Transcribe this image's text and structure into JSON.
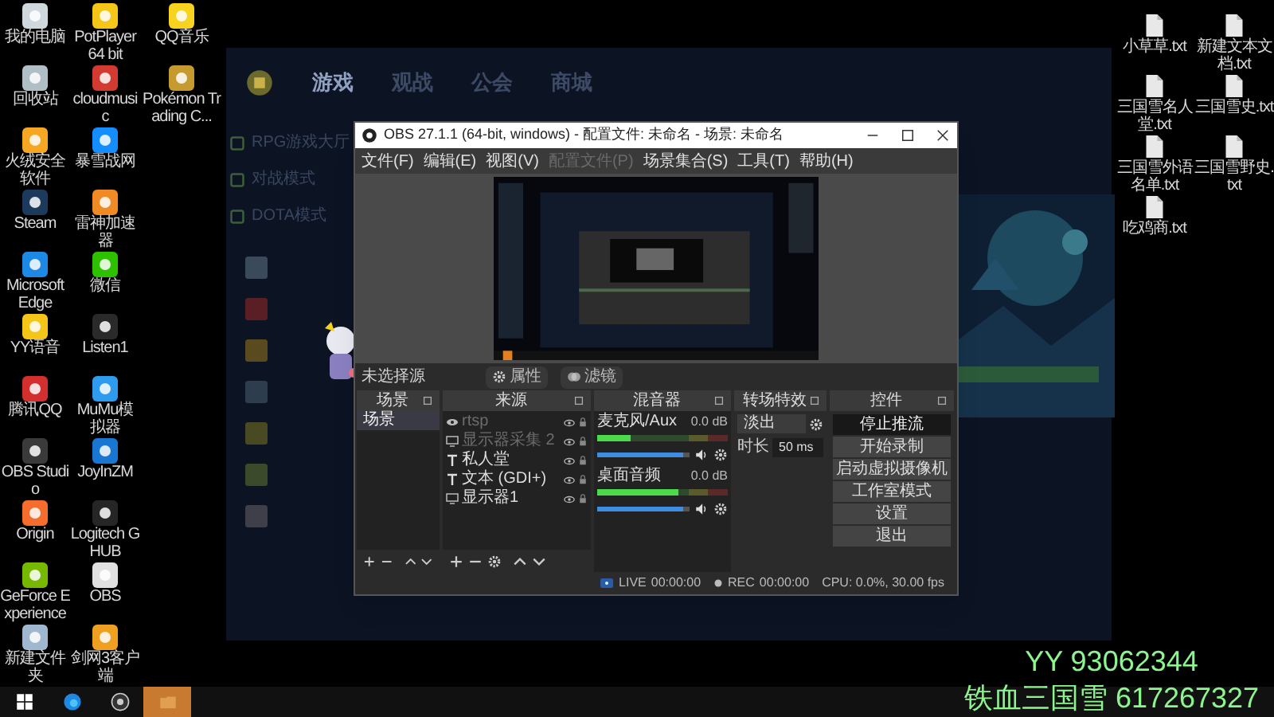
{
  "desktop_left": [
    [
      {
        "label": "我的电脑",
        "color": "#cfd8dc"
      },
      {
        "label": "回收站",
        "color": "#b0bec5"
      },
      {
        "label": "火绒安全软件",
        "color": "#f5a623"
      },
      {
        "label": "Steam",
        "color": "#1b3a5c"
      },
      {
        "label": "Microsoft Edge",
        "color": "#1e88e5"
      },
      {
        "label": "YY语音",
        "color": "#f5c518"
      },
      {
        "label": "腾讯QQ",
        "color": "#d32f2f"
      },
      {
        "label": "OBS Studio",
        "color": "#3a3a3a"
      },
      {
        "label": "Origin",
        "color": "#f56c2d"
      },
      {
        "label": "GeForce Experience",
        "color": "#76b900"
      },
      {
        "label": "新建文件夹",
        "color": "#9fb8d0"
      }
    ],
    [
      {
        "label": "PotPlayer 64 bit",
        "color": "#f5c518"
      },
      {
        "label": "cloudmusic",
        "color": "#d33a31"
      },
      {
        "label": "暴雪战网",
        "color": "#148eff"
      },
      {
        "label": "雷神加速器",
        "color": "#f08a24"
      },
      {
        "label": "微信",
        "color": "#2dc100"
      },
      {
        "label": "Listen1",
        "color": "#2a2a2a"
      },
      {
        "label": "MuMu模拟器",
        "color": "#2f9bef"
      },
      {
        "label": "JoyInZM",
        "color": "#1976d2"
      },
      {
        "label": "Logitech G HUB",
        "color": "#262626"
      },
      {
        "label": "OBS",
        "color": "#e0e0e0"
      },
      {
        "label": "剑网3客户端",
        "color": "#f0a020"
      }
    ],
    [
      {
        "label": "QQ音乐",
        "color": "#f7d21e"
      },
      {
        "label": "Pokémon Trading C...",
        "color": "#c59a2e"
      }
    ]
  ],
  "desktop_right": [
    "小草草.txt",
    "新建文本文档.txt",
    "三国雪名人堂.txt",
    "三国雪史.txt",
    "三国雪外语名单.txt",
    "三国雪野史.txt",
    "吃鸡商.txt"
  ],
  "game_client": {
    "nav": [
      {
        "label": "游戏",
        "selected": true
      },
      {
        "label": "观战",
        "selected": false
      },
      {
        "label": "公会",
        "selected": false
      },
      {
        "label": "商城",
        "selected": false
      }
    ],
    "sidebar": [
      "RPG游戏大厅",
      "对战模式",
      "DOTA模式"
    ]
  },
  "obs": {
    "title": "OBS 27.1.1 (64-bit, windows) - 配置文件: 未命名 - 场景: 未命名",
    "menu": [
      {
        "label": "文件(F)",
        "disabled": false
      },
      {
        "label": "编辑(E)",
        "disabled": false
      },
      {
        "label": "视图(V)",
        "disabled": false
      },
      {
        "label": "配置文件(P)",
        "disabled": true
      },
      {
        "label": "场景集合(S)",
        "disabled": false
      },
      {
        "label": "工具(T)",
        "disabled": false
      },
      {
        "label": "帮助(H)",
        "disabled": false
      }
    ],
    "source_bar": {
      "label": "未选择源",
      "buttons": [
        {
          "label": "属性",
          "kind": "gear"
        },
        {
          "label": "滤镜",
          "kind": "filter"
        }
      ]
    },
    "docks": {
      "scenes": "场景",
      "sources": "来源",
      "mixer": "混音器",
      "transitions": "转场特效",
      "controls": "控件"
    },
    "scenes": [
      {
        "name": "场景",
        "selected": true
      }
    ],
    "sources": [
      {
        "name": "rtsp",
        "kind": "media",
        "disabled": true
      },
      {
        "name": "显示器采集 2",
        "kind": "display",
        "disabled": true
      },
      {
        "name": "私人堂",
        "kind": "text",
        "disabled": false
      },
      {
        "name": "文本 (GDI+)",
        "kind": "text",
        "disabled": false
      },
      {
        "name": "显示器1",
        "kind": "display",
        "disabled": false
      }
    ],
    "mixer": [
      {
        "name": "麦克风/Aux",
        "reading": "0.0 dB",
        "meter": {
          "level": 0.25
        },
        "volume": {
          "level": 0.93
        }
      },
      {
        "name": "桌面音频",
        "reading": "0.0 dB",
        "meter": {
          "level": 0.62
        },
        "volume": {
          "level": 0.93
        }
      }
    ],
    "transition": {
      "type": "淡出",
      "duration_label": "时长",
      "duration": "50 ms"
    },
    "controls": [
      {
        "label": "停止推流",
        "active": true
      },
      {
        "label": "开始录制",
        "active": false
      },
      {
        "label": "启动虚拟摄像机",
        "active": false
      },
      {
        "label": "工作室模式",
        "active": false
      },
      {
        "label": "设置",
        "active": false
      },
      {
        "label": "退出",
        "active": false
      }
    ],
    "status": [
      {
        "label": "LIVE",
        "time": "00:00:00",
        "kind": "live"
      },
      {
        "label": "REC",
        "time": "00:00:00",
        "kind": "rec"
      },
      {
        "label": "CPU: 0.0%, 30.00 fps",
        "kind": "cpu"
      }
    ]
  },
  "overlay": [
    "YY 93062344",
    "铁血三国雪 617267327"
  ],
  "taskbar": [
    {
      "kind": "start",
      "selected": false
    },
    {
      "kind": "edge",
      "selected": false
    },
    {
      "kind": "obs",
      "selected": false
    },
    {
      "kind": "folder",
      "selected": true
    }
  ]
}
